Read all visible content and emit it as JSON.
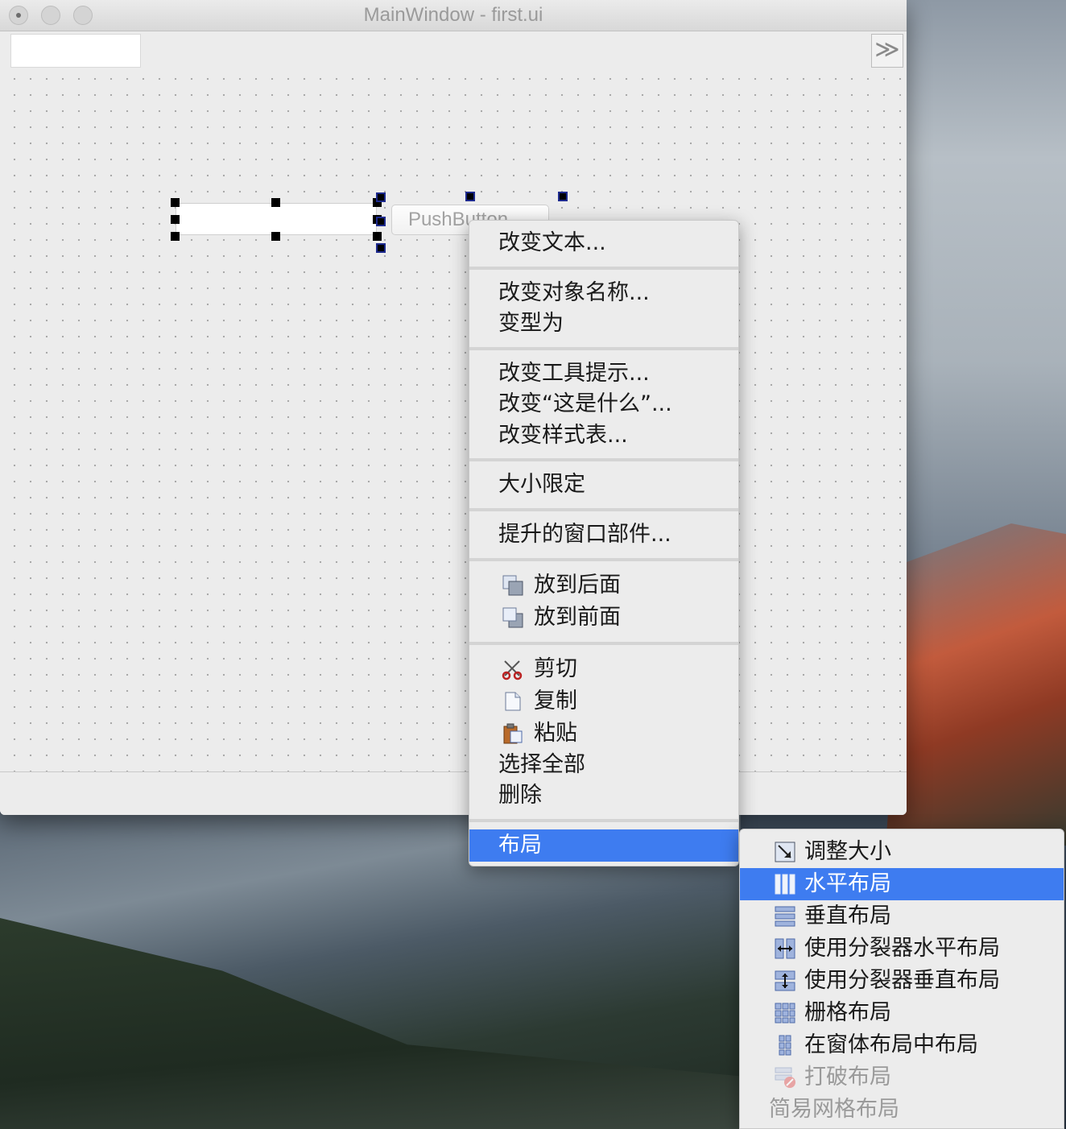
{
  "window": {
    "title": "MainWindow - first.ui",
    "toolbar_extension_glyph": "≫"
  },
  "form": {
    "push_button_text": "PushButton"
  },
  "context_menu": {
    "items": [
      {
        "label": "改变文本..."
      },
      {
        "label": "改变对象名称..."
      },
      {
        "label": "变型为"
      },
      {
        "label": "改变工具提示..."
      },
      {
        "label": "改变“这是什么”..."
      },
      {
        "label": "改变样式表..."
      },
      {
        "label": "大小限定"
      },
      {
        "label": "提升的窗口部件..."
      },
      {
        "label": "放到后面",
        "icon": "send-to-back-icon"
      },
      {
        "label": "放到前面",
        "icon": "bring-to-front-icon"
      },
      {
        "label": "剪切",
        "icon": "scissors-icon"
      },
      {
        "label": "复制",
        "icon": "copy-document-icon"
      },
      {
        "label": "粘贴",
        "icon": "paste-clipboard-icon"
      },
      {
        "label": "选择全部"
      },
      {
        "label": "删除"
      },
      {
        "label": "布局",
        "highlighted": true
      }
    ]
  },
  "layout_submenu": {
    "items": [
      {
        "label": "调整大小",
        "icon": "adjust-size-icon"
      },
      {
        "label": "水平布局",
        "icon": "horizontal-layout-icon",
        "highlighted": true
      },
      {
        "label": "垂直布局",
        "icon": "vertical-layout-icon"
      },
      {
        "label": "使用分裂器水平布局",
        "icon": "horizontal-splitter-icon"
      },
      {
        "label": "使用分裂器垂直布局",
        "icon": "vertical-splitter-icon"
      },
      {
        "label": "栅格布局",
        "icon": "grid-layout-icon"
      },
      {
        "label": "在窗体布局中布局",
        "icon": "form-layout-icon"
      },
      {
        "label": "打破布局",
        "icon": "break-layout-icon",
        "disabled": true
      },
      {
        "label": "简易网格布局",
        "disabled": true
      }
    ]
  },
  "colors": {
    "highlight": "#3e7cf0",
    "menu_background": "#ececec",
    "disabled_text": "#9a9a9a"
  }
}
